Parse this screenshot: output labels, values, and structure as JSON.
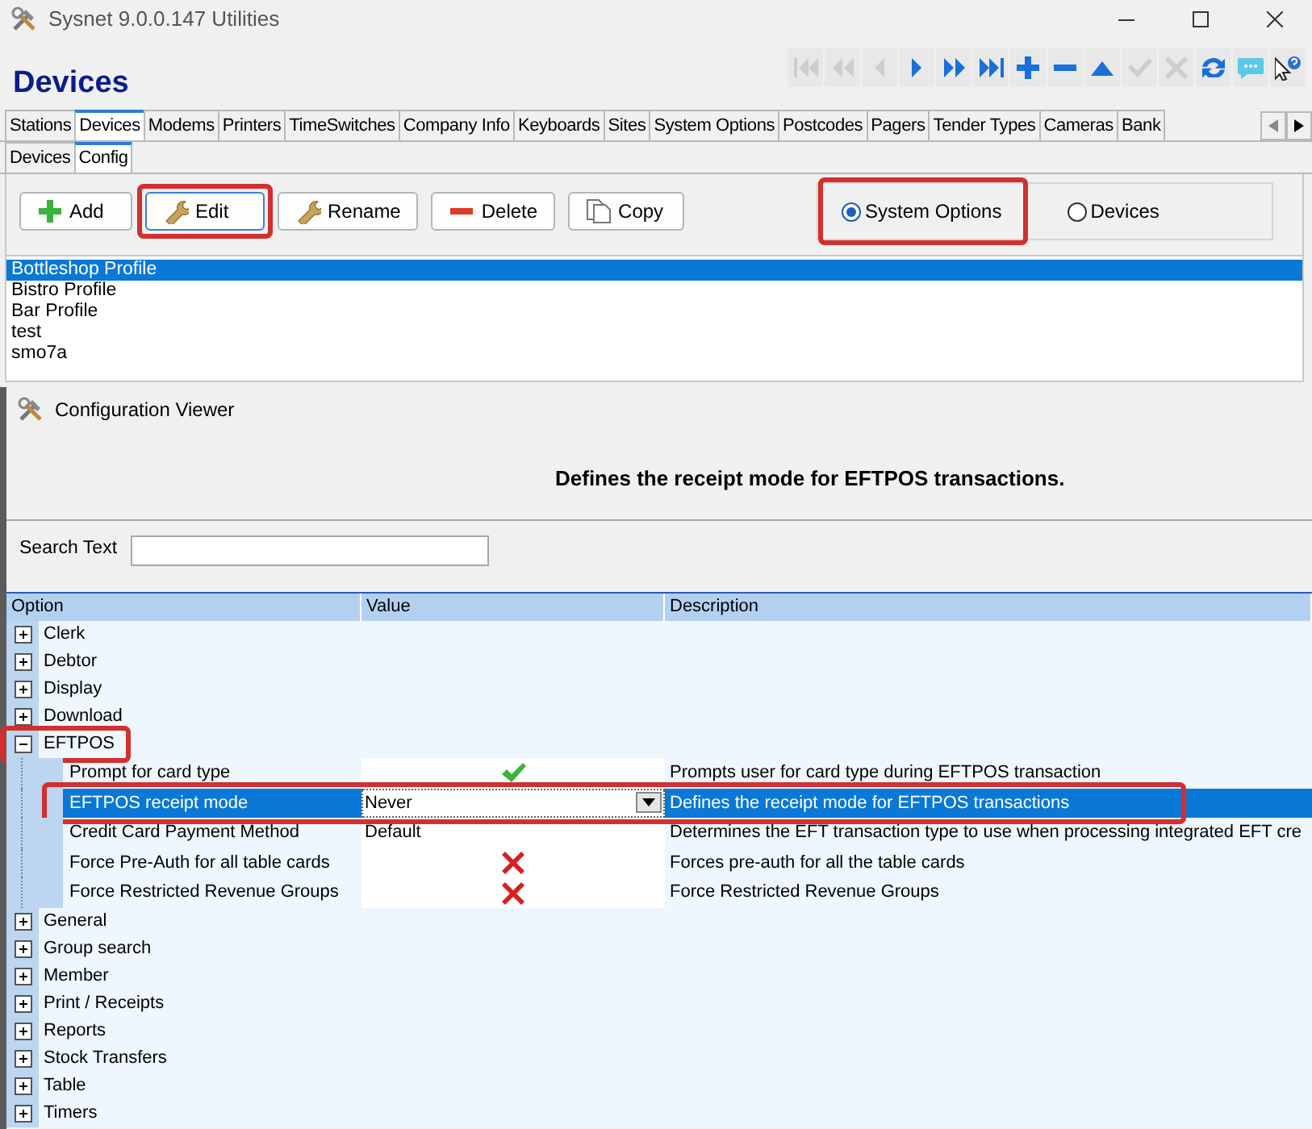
{
  "window": {
    "title": "Sysnet 9.0.0.147 Utilities"
  },
  "page_title": "Devices",
  "toolbar": [
    {
      "kind": "first",
      "disabled": true
    },
    {
      "kind": "prev_page",
      "disabled": true
    },
    {
      "kind": "prev",
      "disabled": true
    },
    {
      "kind": "next",
      "disabled": false
    },
    {
      "kind": "next_page",
      "disabled": false
    },
    {
      "kind": "last",
      "disabled": false
    },
    {
      "kind": "add",
      "disabled": false
    },
    {
      "kind": "remove",
      "disabled": false
    },
    {
      "kind": "up",
      "disabled": false
    },
    {
      "kind": "confirm",
      "disabled": true
    },
    {
      "kind": "cancel",
      "disabled": true
    },
    {
      "kind": "refresh",
      "disabled": false
    },
    {
      "kind": "chat",
      "disabled": false
    },
    {
      "kind": "help",
      "disabled": false
    }
  ],
  "tabs": [
    {
      "label": "Stations",
      "selected": false
    },
    {
      "label": "Devices",
      "selected": true
    },
    {
      "label": "Modems",
      "selected": false
    },
    {
      "label": "Printers",
      "selected": false
    },
    {
      "label": "TimeSwitches",
      "selected": false
    },
    {
      "label": "Company Info",
      "selected": false
    },
    {
      "label": "Keyboards",
      "selected": false
    },
    {
      "label": "Sites",
      "selected": false
    },
    {
      "label": "System Options",
      "selected": false
    },
    {
      "label": "Postcodes",
      "selected": false
    },
    {
      "label": "Pagers",
      "selected": false
    },
    {
      "label": "Tender Types",
      "selected": false
    },
    {
      "label": "Cameras",
      "selected": false
    },
    {
      "label": "Bank",
      "selected": false
    }
  ],
  "subtabs": [
    {
      "label": "Devices",
      "selected": false
    },
    {
      "label": "Config",
      "selected": true
    }
  ],
  "actions": [
    {
      "label": "Add",
      "kind": "add",
      "annotated": false
    },
    {
      "label": "Edit",
      "kind": "edit",
      "annotated": true
    },
    {
      "label": "Rename",
      "kind": "rename",
      "annotated": false
    },
    {
      "label": "Delete",
      "kind": "delete",
      "annotated": false
    },
    {
      "label": "Copy",
      "kind": "copy",
      "annotated": false
    }
  ],
  "mode_options": [
    {
      "label": "System Options",
      "selected": true,
      "annotated": true
    },
    {
      "label": "Devices",
      "selected": false,
      "annotated": false
    }
  ],
  "profiles": [
    {
      "label": "Bottleshop Profile",
      "selected": true
    },
    {
      "label": "Bistro Profile",
      "selected": false
    },
    {
      "label": "Bar Profile",
      "selected": false
    },
    {
      "label": "test",
      "selected": false
    },
    {
      "label": "smo7a",
      "selected": false
    }
  ],
  "config_viewer": {
    "title": "Configuration Viewer",
    "description": "Defines the receipt mode for EFTPOS transactions.",
    "search": {
      "label": "Search Text"
    },
    "columns": [
      "Option",
      "Value",
      "Description"
    ],
    "groups": [
      {
        "label": "Clerk",
        "expanded": false,
        "annotated": false
      },
      {
        "label": "Debtor",
        "expanded": false,
        "annotated": false
      },
      {
        "label": "Display",
        "expanded": false,
        "annotated": false
      },
      {
        "label": "Download",
        "expanded": false,
        "annotated": false
      },
      {
        "label": "EFTPOS",
        "expanded": true,
        "annotated": true,
        "children": [
          {
            "label": "Prompt for card type",
            "kind": "check",
            "description": "Prompts user for card type during EFTPOS transaction",
            "selected": false,
            "annotated": false
          },
          {
            "label": "EFTPOS receipt mode",
            "kind": "dropdown",
            "value": "Never",
            "description": "Defines the receipt mode for EFTPOS transactions",
            "selected": true,
            "annotated": true
          },
          {
            "label": "Credit Card Payment Method",
            "kind": "text",
            "value": "Default",
            "description": "Determines the EFT transaction type to use when processing integrated EFT cre",
            "selected": false,
            "annotated": false
          },
          {
            "label": "Force Pre-Auth for all table cards",
            "kind": "cross",
            "description": "Forces pre-auth for all the table cards",
            "selected": false,
            "annotated": false
          },
          {
            "label": "Force Restricted Revenue Groups",
            "kind": "cross",
            "description": "Force Restricted Revenue Groups",
            "selected": false,
            "annotated": false
          }
        ]
      },
      {
        "label": "General",
        "expanded": false,
        "annotated": false
      },
      {
        "label": "Group search",
        "expanded": false,
        "annotated": false
      },
      {
        "label": "Member",
        "expanded": false,
        "annotated": false
      },
      {
        "label": "Print / Receipts",
        "expanded": false,
        "annotated": false
      },
      {
        "label": "Reports",
        "expanded": false,
        "annotated": false
      },
      {
        "label": "Stock Transfers",
        "expanded": false,
        "annotated": false
      },
      {
        "label": "Table",
        "expanded": false,
        "annotated": false
      },
      {
        "label": "Timers",
        "expanded": false,
        "annotated": false
      }
    ]
  }
}
